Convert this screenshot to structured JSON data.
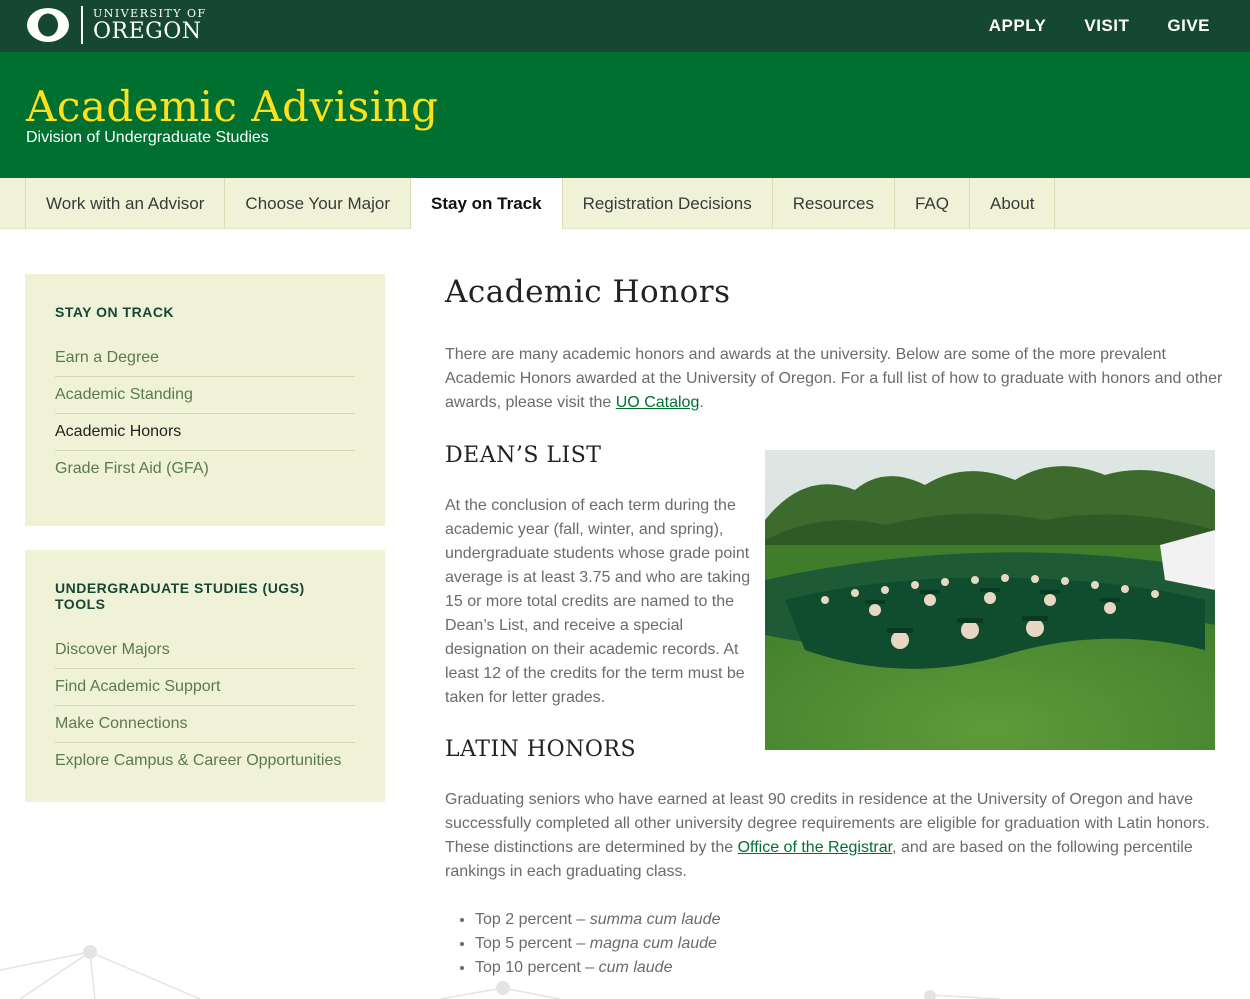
{
  "header": {
    "logo_line1": "UNIVERSITY OF",
    "logo_line2": "OREGON",
    "links": [
      "APPLY",
      "VISIT",
      "GIVE"
    ]
  },
  "banner": {
    "title": "Academic Advising",
    "subtitle": "Division of Undergraduate Studies"
  },
  "nav": {
    "items": [
      "Work with an Advisor",
      "Choose Your Major",
      "Stay on Track",
      "Registration Decisions",
      "Resources",
      "FAQ",
      "About"
    ],
    "active": "Stay on Track"
  },
  "sidebar": {
    "box1": {
      "heading": "STAY ON TRACK",
      "items": [
        "Earn a Degree",
        "Academic Standing",
        "Academic Honors",
        "Grade First Aid (GFA)"
      ],
      "current": "Academic Honors"
    },
    "box2": {
      "heading": "UNDERGRADUATE STUDIES (UGS) TOOLS",
      "items": [
        "Discover Majors",
        "Find Academic Support",
        "Make Connections",
        "Explore Campus & Career Opportunities"
      ]
    }
  },
  "content": {
    "title": "Academic Honors",
    "intro_pre": "There are many academic honors and awards at the university. Below are some of the more prevalent Academic Honors awarded at the University of Oregon. For a full list of how to graduate with honors and other awards, please visit the ",
    "intro_link": "UO Catalog",
    "intro_post": ".",
    "deans_heading": "DEAN’S LIST",
    "deans_text": "At the conclusion of each term during the academic year (fall, winter, and spring), undergraduate students whose grade point average is at least 3.75 and who are taking 15 or more total credits are named to the Dean’s List, and receive a special designation on their academic records. At least 12 of the credits for the term must be taken for letter grades.",
    "latin_heading": "LATIN HONORS",
    "latin_pre": "Graduating seniors who have earned at least 90 credits in residence at the University of Oregon and have successfully completed all other university degree requirements are eligible for graduation with Latin honors. These distinctions are determined by the ",
    "latin_link": "Office of the Registrar",
    "latin_post": ", and are based on the following percentile rankings in each graduating class.",
    "honors": [
      {
        "label": "Top 2 percent – ",
        "latin": "summa cum laude"
      },
      {
        "label": "Top 5 percent – ",
        "latin": "magna cum laude"
      },
      {
        "label": "Top 10 percent – ",
        "latin": "cum laude"
      }
    ]
  },
  "colors": {
    "dark_green": "#154733",
    "green": "#007030",
    "yellow": "#fee11a",
    "light": "#eff2d6"
  }
}
